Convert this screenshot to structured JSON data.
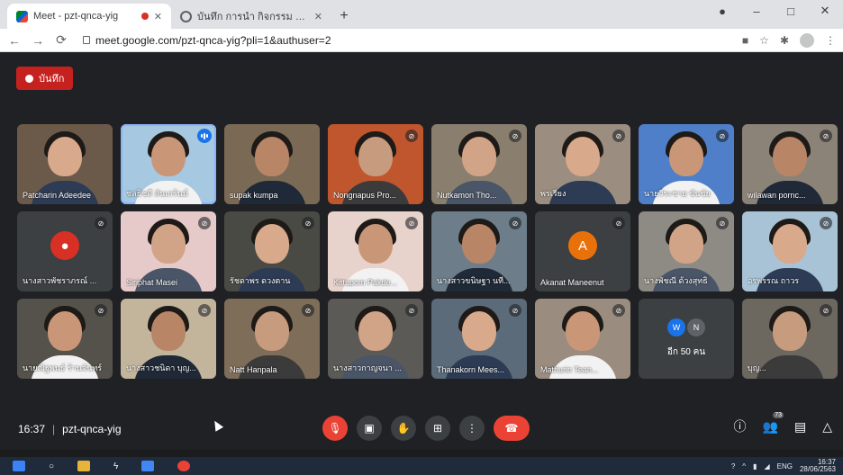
{
  "browser": {
    "tabs": [
      {
        "title": "Meet - pzt-qnca-yig",
        "active": true
      },
      {
        "title": "บันทึก การนำ กิจกรรม หน่วยคลิก",
        "active": false
      }
    ],
    "url": "meet.google.com/pzt-qnca-yig?pli=1&authuser=2"
  },
  "meet": {
    "record_label": "บันทึก",
    "participants": [
      {
        "name": "Patcharin Adeedee",
        "kind": "video",
        "muted": false
      },
      {
        "name": "ชลธิชดี สันเกร้นม์",
        "kind": "video",
        "speaking": true
      },
      {
        "name": "supak kumpa",
        "kind": "video",
        "muted": false
      },
      {
        "name": "Nongnapus Pro...",
        "kind": "video",
        "muted": true
      },
      {
        "name": "Nutkamon Tho...",
        "kind": "video",
        "muted": true
      },
      {
        "name": "พรเรียง",
        "kind": "video",
        "muted": true
      },
      {
        "name": "นายวีระชาย ขันชัย",
        "kind": "video",
        "muted": true
      },
      {
        "name": "wilawan pornc...",
        "kind": "video",
        "muted": true
      },
      {
        "name": "นางสาวพัชราภรณ์ ...",
        "kind": "avatar",
        "muted": true
      },
      {
        "name": "Siriphat Masei",
        "kind": "video",
        "muted": true
      },
      {
        "name": "รัชดาพร ดวงตาน",
        "kind": "video",
        "muted": true
      },
      {
        "name": "Kittupom Pakde...",
        "kind": "video",
        "muted": true
      },
      {
        "name": "นางสาวขนิษฐา นที...",
        "kind": "video",
        "muted": true
      },
      {
        "name": "Akanat Maneenut",
        "kind": "avatar",
        "initial": "A",
        "muted": true
      },
      {
        "name": "นางพัชณี ด้วงสุทธิ",
        "kind": "video",
        "muted": true
      },
      {
        "name": "อรพรรณ ถาวร",
        "kind": "video",
        "muted": true
      },
      {
        "name": "นายณัฐพนธ์ ร้านจันทร์",
        "kind": "video",
        "muted": true
      },
      {
        "name": "นางสาวชนิดา บุญ...",
        "kind": "video",
        "muted": true
      },
      {
        "name": "Natt Hanpala",
        "kind": "video",
        "muted": true
      },
      {
        "name": "นางสาวกาญจนา ...",
        "kind": "video",
        "muted": true
      },
      {
        "name": "Thanakorn Mees...",
        "kind": "video",
        "muted": true
      },
      {
        "name": "Mathurin Tean...",
        "kind": "video",
        "muted": true
      },
      {
        "name": "อีก 50 คน",
        "kind": "more",
        "initials": [
          "W",
          "N"
        ]
      },
      {
        "name": "บุญ...",
        "kind": "video",
        "muted": true
      }
    ],
    "time": "16:37",
    "separator": "|",
    "meeting_code": "pzt-qnca-yig",
    "people_count": "73"
  },
  "taskbar": {
    "language": "ENG",
    "clock_time": "16:37",
    "clock_date": "28/06/2563"
  },
  "colors": {
    "record": "#c5221f",
    "hangup": "#ea4335",
    "speaking_outline": "#8ab4f8"
  }
}
